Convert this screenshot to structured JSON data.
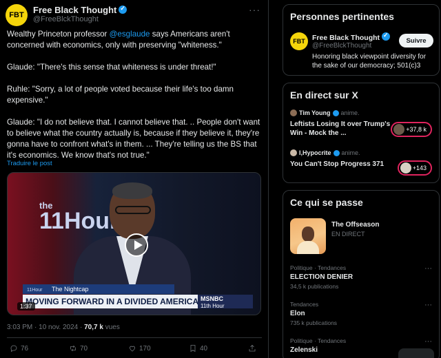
{
  "post": {
    "author": "Free Black Thought",
    "avatar_text": "FBT",
    "handle": "@FreeBlckThought",
    "text_p1_before": "Wealthy Princeton professor ",
    "text_p1_mention": "@esglaude",
    "text_p1_after": " says Americans aren't concerned with economics, only with preserving \"whiteness.\"",
    "text_p2": "Glaude: \"There's this sense that whiteness is under threat!\"",
    "text_p3": "Ruhle: \"Sorry, a lot of people voted because their life's too damn expensive.\"",
    "text_p4": "Glaude: \"I do not believe that. I cannot believe that. .. People don't want to believe what the country actually is, because if they believe it, they're gonna have to confront what's in them. ... They're telling us the BS that it's economics. We know that's not true.\"",
    "translate": "Traduire le post",
    "time": "3:03 PM · 10 nov. 2024 · ",
    "views_count": "70,7 k",
    "views_label": " vues",
    "replies": "76",
    "reposts": "70",
    "likes": "170",
    "bookmarks": "40"
  },
  "media": {
    "show_the": "the",
    "show_num": "11Hour",
    "segment_small": "The Nightcap",
    "segment_mini_logo": "11Hour",
    "headline": "MOVING FORWARD IN A DIVIDED AMERICA",
    "network": "MSNBC",
    "network_show": "11th Hour",
    "duration": "1:37"
  },
  "sidebar": {
    "people": {
      "title": "Personnes pertinentes",
      "name": "Free Black Thought",
      "avatar_text": "FBT",
      "handle": "@FreeBlckThought",
      "bio": "Honoring black viewpoint diversity for the sake of our democracy; 501(c)3",
      "follow_label": "Suivre"
    },
    "live": {
      "title": "En direct sur X",
      "items": [
        {
          "user": "Tim Young",
          "tag": "anime.",
          "title": "Leftists Losing It over Trump's Win - Mock the ...",
          "count": "+37,8 k"
        },
        {
          "user": "I,Hypocrite",
          "tag": "anime.",
          "title": "You Can't Stop Progress 371",
          "count": "+143"
        }
      ]
    },
    "happening": {
      "title": "Ce qui se passe",
      "event_name": "The Offseason",
      "event_status": "EN DIRECT",
      "trends": [
        {
          "category": "Politique · Tendances",
          "name": "ELECTION DENIER",
          "posts": "34,5 k publications"
        },
        {
          "category": "Tendances",
          "name": "Elon",
          "posts": "735 k publications"
        },
        {
          "category": "Politique · Tendances",
          "name": "Zelenski",
          "posts": ""
        }
      ]
    }
  },
  "colors": {
    "accent": "#1d9bf0",
    "background": "#000000",
    "text": "#e7e9ea",
    "muted": "#71767b",
    "live_ring": "#e0245e",
    "fbt_yellow": "#f5d50b"
  }
}
